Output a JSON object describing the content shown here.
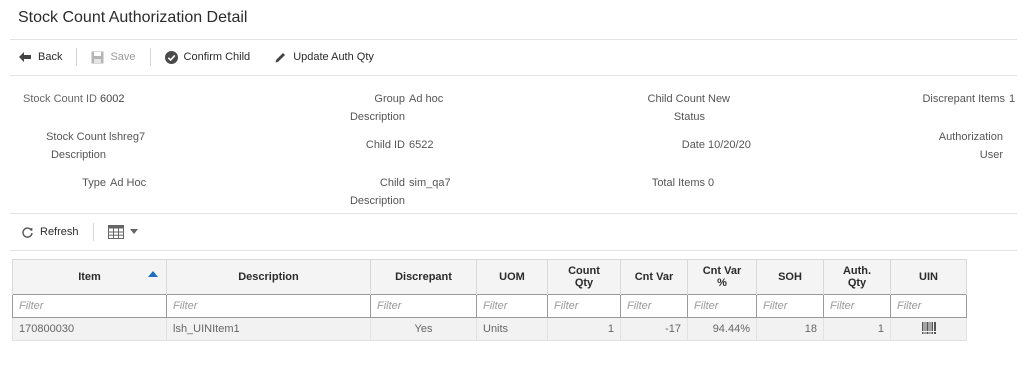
{
  "page": {
    "title": "Stock Count Authorization Detail"
  },
  "toolbar": {
    "back_label": "Back",
    "save_label": "Save",
    "confirm_child_label": "Confirm Child",
    "update_auth_qty_label": "Update Auth Qty"
  },
  "details": {
    "stock_count_id": {
      "label": "Stock Count ID",
      "value": "6002"
    },
    "stock_count_description": {
      "label_line1": "Stock Count",
      "label_line2": "Description",
      "value": "lshreg7"
    },
    "type": {
      "label": "Type",
      "value": "Ad Hoc"
    },
    "group_description": {
      "label_line1": "Group",
      "label_line2": "Description",
      "value": "Ad hoc"
    },
    "child_id": {
      "label": "Child ID",
      "value": "6522"
    },
    "child_description": {
      "label_line1": "Child",
      "label_line2": "Description",
      "value": "sim_qa7"
    },
    "child_count_status": {
      "label_line1": "Child Count",
      "label_line2": "Status",
      "value": "New"
    },
    "date": {
      "label": "Date",
      "value": "10/20/20"
    },
    "total_items": {
      "label": "Total Items",
      "value": "0"
    },
    "discrepant_items": {
      "label": "Discrepant Items",
      "value": "1"
    },
    "authorization_user": {
      "label_line1": "Authorization",
      "label_line2": "User",
      "value": ""
    }
  },
  "table_toolbar": {
    "refresh_label": "Refresh"
  },
  "table": {
    "columns": {
      "item": "Item",
      "description": "Description",
      "discrepant": "Discrepant",
      "uom": "UOM",
      "count_qty_1": "Count",
      "count_qty_2": "Qty",
      "cnt_var": "Cnt Var",
      "cnt_var_pct_1": "Cnt Var",
      "cnt_var_pct_2": "%",
      "soh": "SOH",
      "auth_qty_1": "Auth.",
      "auth_qty_2": "Qty",
      "uin": "UIN"
    },
    "filter_placeholder": "Filter",
    "rows": [
      {
        "item": "170800030",
        "description": "lsh_UINItem1",
        "discrepant": "Yes",
        "uom": "Units",
        "count_qty": "1",
        "cnt_var": "-17",
        "cnt_var_pct": "94.44%",
        "soh": "18",
        "auth_qty": "1",
        "uin_icon": "barcode-icon"
      }
    ]
  }
}
